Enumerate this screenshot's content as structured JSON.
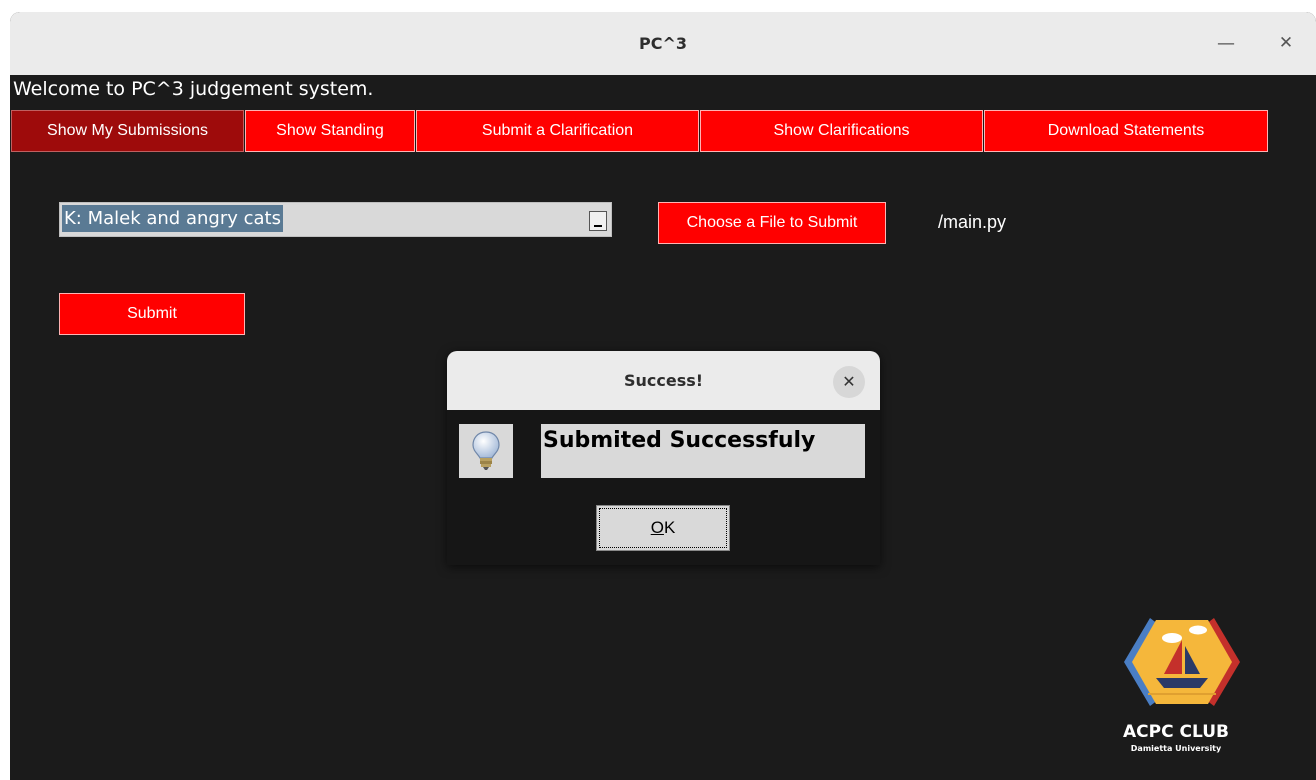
{
  "window": {
    "title": "PC^3",
    "minimize_glyph": "—",
    "close_glyph": "✕"
  },
  "welcome_text": "Welcome to PC^3 judgement system.",
  "tabs": [
    {
      "label": "Show My Submissions",
      "active": true
    },
    {
      "label": "Show Standing",
      "active": false
    },
    {
      "label": "Submit a Clarification",
      "active": false
    },
    {
      "label": "Show Clarifications",
      "active": false
    },
    {
      "label": "Download Statements",
      "active": false
    }
  ],
  "problem_select": {
    "selected": "K: Malek and angry cats"
  },
  "choose_file_button": "Choose a File to Submit",
  "file_label": "/main.py",
  "submit_button": "Submit",
  "dialog": {
    "title": "Success!",
    "close_glyph": "✕",
    "icon": "lightbulb-icon",
    "message": "Submited Successfuly",
    "ok_mnemonic": "O",
    "ok_rest": "K"
  },
  "logo": {
    "name": "ACPC CLUB",
    "subtitle": "Damietta University"
  },
  "colors": {
    "accent": "#ff0000",
    "active_tab": "#9e0b0b",
    "background": "#1b1b1b",
    "titlebar": "#ebebeb"
  }
}
